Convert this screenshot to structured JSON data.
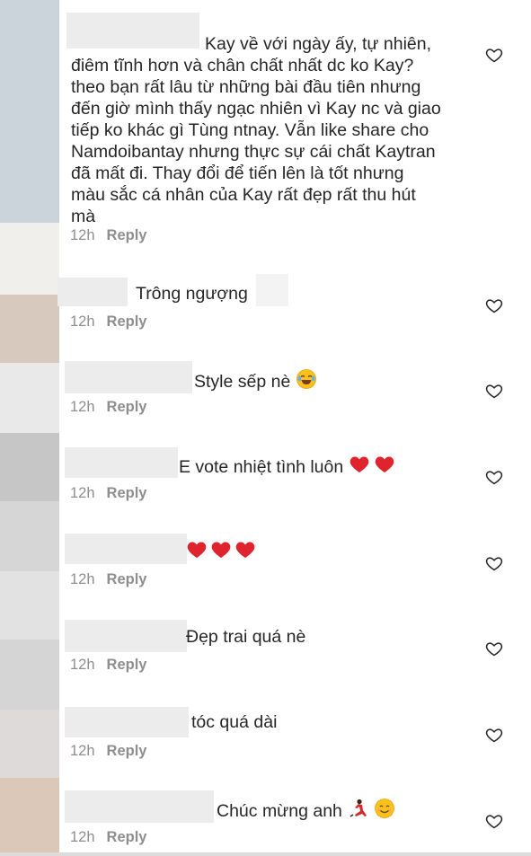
{
  "comments": [
    {
      "lines": [
        "Kay về với ngày ấy, tự nhiên,",
        "điêm tĩnh hơn và chân chất nhất dc ko Kay?",
        "theo bạn rất lâu từ những bài đầu tiên nhưng",
        "đến giờ mình thấy ngạc nhiên vì Kay nc và giao",
        "tiếp ko khác gì Tùng ntnay. Vẫn like share cho",
        "Namdoibantay nhưng thực sự cái chất Kaytran",
        "đã mất đi. Thay đổi để tiến lên là tốt nhưng",
        "màu sắc cá nhân của Kay rất đẹp rất thu hút",
        "mà"
      ],
      "time": "12h",
      "reply": "Reply"
    },
    {
      "text": "Trông ngượng",
      "time": "12h",
      "reply": "Reply"
    },
    {
      "text": "Style sếp nè",
      "emoji": "joy-emoji",
      "time": "12h",
      "reply": "Reply"
    },
    {
      "text": "E vote nhiệt tình luôn",
      "emoji": "two-hearts-emoji",
      "time": "12h",
      "reply": "Reply"
    },
    {
      "text": "",
      "emoji": "three-hearts-emoji",
      "time": "12h",
      "reply": "Reply"
    },
    {
      "text": "Đẹp trai quá nè",
      "time": "12h",
      "reply": "Reply"
    },
    {
      "text": "tóc quá dài",
      "time": "12h",
      "reply": "Reply"
    },
    {
      "text": "Chúc mừng anh",
      "emoji": "dancer-smile-emoji",
      "time": "12h",
      "reply": "Reply"
    }
  ],
  "colors": {
    "text": "#262626",
    "meta": "#8e8e8e",
    "heart_red": "#e0242e"
  },
  "icons": {
    "like": "heart-outline-icon"
  }
}
